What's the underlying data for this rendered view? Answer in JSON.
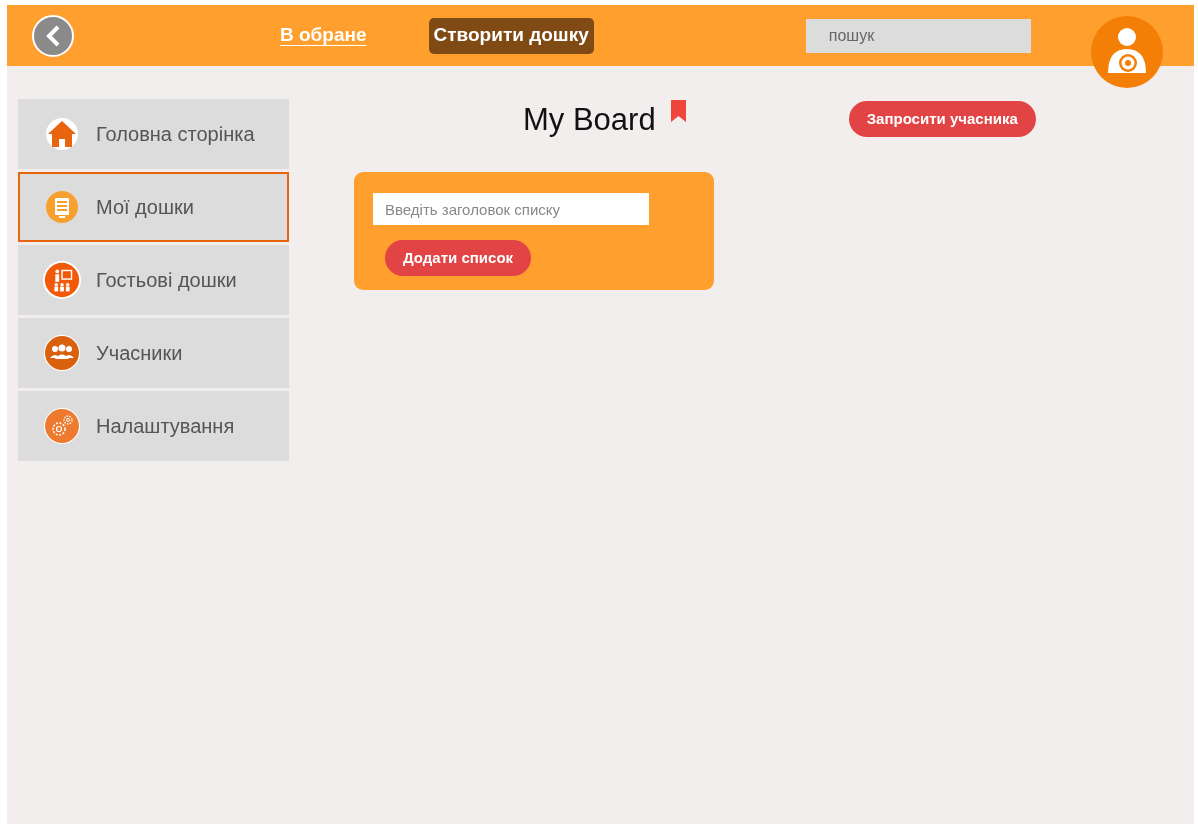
{
  "header": {
    "favorites_link": "В обране",
    "create_board_button": "Створити дошку",
    "search": {
      "placeholder": "пошук"
    }
  },
  "sidebar": {
    "items": [
      {
        "label": "Головна сторінка",
        "selected": false
      },
      {
        "label": "Мої дошки",
        "selected": true
      },
      {
        "label": "Гостьові дошки",
        "selected": false
      },
      {
        "label": "Учасники",
        "selected": false
      },
      {
        "label": "Налаштування",
        "selected": false
      }
    ]
  },
  "board": {
    "title": "My Board",
    "bookmarked": true,
    "invite_button": "Запросити учасника",
    "add_list": {
      "placeholder": "Введіть заголовок списку",
      "button": "Додати список"
    }
  }
}
